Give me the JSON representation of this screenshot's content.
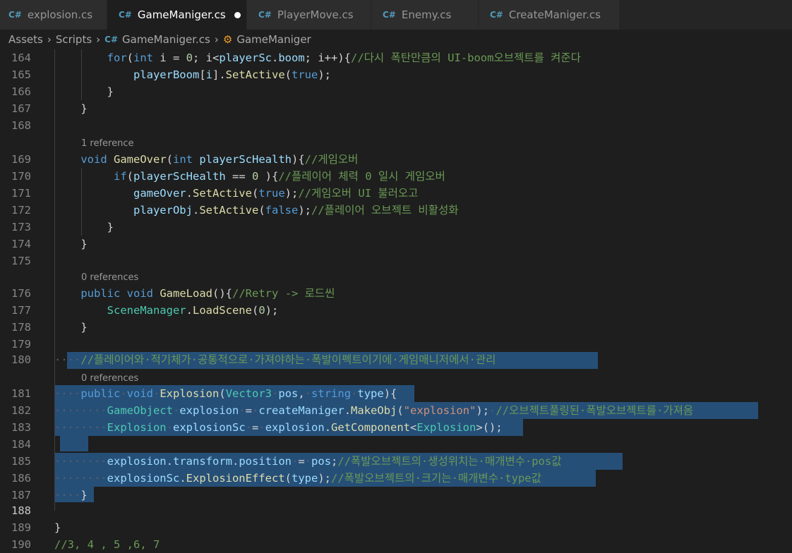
{
  "tabs": [
    {
      "label": "explosion.cs",
      "active": false,
      "modified": false
    },
    {
      "label": "GameManiger.cs",
      "active": true,
      "modified": true
    },
    {
      "label": "PlayerMove.cs",
      "active": false,
      "modified": false
    },
    {
      "label": "Enemy.cs",
      "active": false,
      "modified": false
    },
    {
      "label": "CreateManiger.cs",
      "active": false,
      "modified": false
    }
  ],
  "breadcrumb": {
    "items": [
      "Assets",
      "Scripts",
      "GameManiger.cs",
      "GameManiger"
    ]
  },
  "icons": {
    "csharp_file": "csharp-file-icon",
    "class": "class-icon"
  },
  "colors": {
    "keyword": "#569cd6",
    "type": "#4ec9b0",
    "method": "#dcdcaa",
    "variable": "#9cdcfe",
    "number": "#b5cea8",
    "string": "#ce9178",
    "comment": "#6a9955",
    "selection": "#264f78",
    "background": "#1e1e1e"
  },
  "codelens": {
    "ref1": "1 reference",
    "ref2": "0 references",
    "ref3": "0 references"
  },
  "lines": [
    {
      "num": "164",
      "tokens": [
        [
          "ws",
          "        "
        ],
        [
          "k",
          "for"
        ],
        [
          "p",
          "("
        ],
        [
          "k",
          "int"
        ],
        [
          "p",
          " i = "
        ],
        [
          "n",
          "0"
        ],
        [
          "p",
          "; i<"
        ],
        [
          "v",
          "playerSc"
        ],
        [
          "p",
          "."
        ],
        [
          "v",
          "boom"
        ],
        [
          "p",
          "; i++){"
        ],
        [
          "c",
          "//다시 폭탄만큼의 UI-boom오브젝트를 켜준다"
        ]
      ]
    },
    {
      "num": "165",
      "tokens": [
        [
          "ws",
          "            "
        ],
        [
          "v",
          "playerBoom"
        ],
        [
          "p",
          "["
        ],
        [
          "v",
          "i"
        ],
        [
          "p",
          "]."
        ],
        [
          "f",
          "SetActive"
        ],
        [
          "p",
          "("
        ],
        [
          "k",
          "true"
        ],
        [
          "p",
          ");"
        ]
      ]
    },
    {
      "num": "166",
      "tokens": [
        [
          "ws",
          "        "
        ],
        [
          "p",
          "}"
        ]
      ]
    },
    {
      "num": "167",
      "tokens": [
        [
          "ws",
          "    "
        ],
        [
          "p",
          "}"
        ]
      ]
    },
    {
      "num": "168",
      "tokens": []
    },
    {
      "num": "169",
      "tokens": [
        [
          "ws",
          "    "
        ],
        [
          "k",
          "void"
        ],
        [
          "p",
          " "
        ],
        [
          "f",
          "GameOver"
        ],
        [
          "p",
          "("
        ],
        [
          "k",
          "int"
        ],
        [
          "p",
          " "
        ],
        [
          "v",
          "playerScHealth"
        ],
        [
          "p",
          "){"
        ],
        [
          "c",
          "//게임오버"
        ]
      ]
    },
    {
      "num": "170",
      "tokens": [
        [
          "ws",
          "         "
        ],
        [
          "k",
          "if"
        ],
        [
          "p",
          "("
        ],
        [
          "v",
          "playerScHealth"
        ],
        [
          "p",
          " == "
        ],
        [
          "n",
          "0"
        ],
        [
          "p",
          " ){"
        ],
        [
          "c",
          "//플레이어 체력 0 일시 게임오버"
        ]
      ]
    },
    {
      "num": "171",
      "tokens": [
        [
          "ws",
          "            "
        ],
        [
          "v",
          "gameOver"
        ],
        [
          "p",
          "."
        ],
        [
          "f",
          "SetActive"
        ],
        [
          "p",
          "("
        ],
        [
          "k",
          "true"
        ],
        [
          "p",
          ");"
        ],
        [
          "c",
          "//게임오버 UI 불러오고"
        ]
      ]
    },
    {
      "num": "172",
      "tokens": [
        [
          "ws",
          "            "
        ],
        [
          "v",
          "playerObj"
        ],
        [
          "p",
          "."
        ],
        [
          "f",
          "SetActive"
        ],
        [
          "p",
          "("
        ],
        [
          "k",
          "false"
        ],
        [
          "p",
          ");"
        ],
        [
          "c",
          "//플레이어 오브젝트 비활성화"
        ]
      ]
    },
    {
      "num": "173",
      "tokens": [
        [
          "ws",
          "        "
        ],
        [
          "p",
          "}"
        ]
      ]
    },
    {
      "num": "174",
      "tokens": [
        [
          "ws",
          "    "
        ],
        [
          "p",
          "}"
        ]
      ]
    },
    {
      "num": "175",
      "tokens": []
    },
    {
      "num": "176",
      "tokens": [
        [
          "ws",
          "    "
        ],
        [
          "k",
          "public"
        ],
        [
          "p",
          " "
        ],
        [
          "k",
          "void"
        ],
        [
          "p",
          " "
        ],
        [
          "f",
          "GameLoad"
        ],
        [
          "p",
          "(){"
        ],
        [
          "c",
          "//Retry -> 로드씬"
        ]
      ]
    },
    {
      "num": "177",
      "tokens": [
        [
          "ws",
          "        "
        ],
        [
          "t",
          "SceneManager"
        ],
        [
          "p",
          "."
        ],
        [
          "f",
          "LoadScene"
        ],
        [
          "p",
          "("
        ],
        [
          "n",
          "0"
        ],
        [
          "p",
          ");"
        ]
      ]
    },
    {
      "num": "178",
      "tokens": [
        [
          "ws",
          "    "
        ],
        [
          "p",
          "}"
        ]
      ]
    },
    {
      "num": "179",
      "tokens": []
    },
    {
      "num": "180",
      "tokens": [
        [
          "ws",
          "····"
        ],
        [
          "c",
          "//플레이어와·적기체가·공통적으로·가져야하는·폭발이펙트이기에·게임매니저에서·관리"
        ]
      ]
    },
    {
      "num": "181",
      "tokens": [
        [
          "ws",
          "····"
        ],
        [
          "k",
          "public"
        ],
        [
          "ws",
          "·"
        ],
        [
          "k",
          "void"
        ],
        [
          "ws",
          "·"
        ],
        [
          "f",
          "Explosion"
        ],
        [
          "p",
          "("
        ],
        [
          "t",
          "Vector3"
        ],
        [
          "ws",
          "·"
        ],
        [
          "v",
          "pos"
        ],
        [
          "p",
          ","
        ],
        [
          "ws",
          "·"
        ],
        [
          "k",
          "string"
        ],
        [
          "ws",
          "·"
        ],
        [
          "v",
          "type"
        ],
        [
          "p",
          "){"
        ]
      ]
    },
    {
      "num": "182",
      "tokens": [
        [
          "ws",
          "········"
        ],
        [
          "t",
          "GameObject"
        ],
        [
          "ws",
          "·"
        ],
        [
          "v",
          "explosion"
        ],
        [
          "ws",
          "·"
        ],
        [
          "p",
          "="
        ],
        [
          "ws",
          "·"
        ],
        [
          "v",
          "createManiger"
        ],
        [
          "p",
          "."
        ],
        [
          "f",
          "MakeObj"
        ],
        [
          "p",
          "("
        ],
        [
          "s",
          "\"explosion\""
        ],
        [
          "p",
          ");"
        ],
        [
          "ws",
          "·"
        ],
        [
          "c",
          "//오브젝트풀링된·폭발오브젝트를·가져옴"
        ]
      ]
    },
    {
      "num": "183",
      "tokens": [
        [
          "ws",
          "········"
        ],
        [
          "t",
          "Explosion"
        ],
        [
          "ws",
          "·"
        ],
        [
          "v",
          "explosionSc"
        ],
        [
          "ws",
          "·"
        ],
        [
          "p",
          "="
        ],
        [
          "ws",
          "·"
        ],
        [
          "v",
          "explosion"
        ],
        [
          "p",
          "."
        ],
        [
          "f",
          "GetComponent"
        ],
        [
          "p",
          "<"
        ],
        [
          "t",
          "Explosion"
        ],
        [
          "p",
          ">();"
        ]
      ]
    },
    {
      "num": "184",
      "tokens": []
    },
    {
      "num": "185",
      "tokens": [
        [
          "ws",
          "········"
        ],
        [
          "v",
          "explosion"
        ],
        [
          "p",
          "."
        ],
        [
          "v",
          "transform"
        ],
        [
          "p",
          "."
        ],
        [
          "v",
          "position"
        ],
        [
          "ws",
          "·"
        ],
        [
          "p",
          "="
        ],
        [
          "ws",
          "·"
        ],
        [
          "v",
          "pos"
        ],
        [
          "p",
          ";"
        ],
        [
          "c",
          "//폭발오브젝트의·생성위치는·매개변수·pos값"
        ]
      ]
    },
    {
      "num": "186",
      "tokens": [
        [
          "ws",
          "········"
        ],
        [
          "v",
          "explosionSc"
        ],
        [
          "p",
          "."
        ],
        [
          "f",
          "ExplosionEffect"
        ],
        [
          "p",
          "("
        ],
        [
          "v",
          "type"
        ],
        [
          "p",
          ");"
        ],
        [
          "c",
          "//폭발오브젝트의·크기는·매개변수·type값"
        ]
      ]
    },
    {
      "num": "187",
      "tokens": [
        [
          "ws",
          "····"
        ],
        [
          "p",
          "}"
        ]
      ]
    },
    {
      "num": "188",
      "tokens": []
    },
    {
      "num": "189",
      "tokens": [
        [
          "p",
          "}"
        ]
      ]
    },
    {
      "num": "190",
      "tokens": [
        [
          "c",
          "//3, 4 , 5 ,6, 7"
        ]
      ]
    }
  ]
}
